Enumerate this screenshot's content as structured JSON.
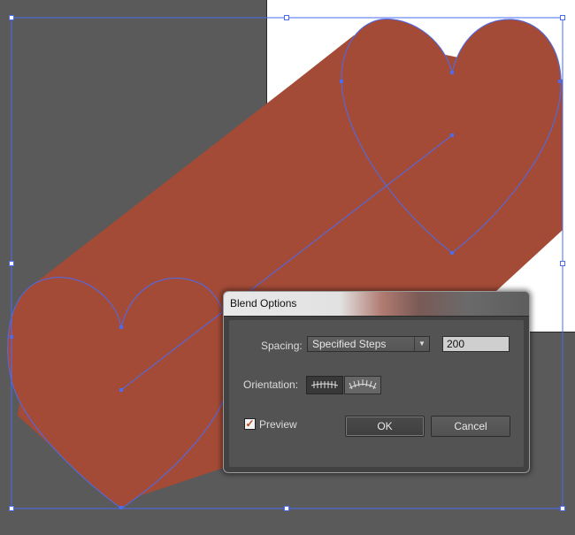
{
  "dialog": {
    "title": "Blend Options",
    "spacing_label": "Spacing:",
    "spacing_value": "Specified Steps",
    "steps_value": "200",
    "orientation_label": "Orientation:",
    "orientation_options": [
      "Align to Page",
      "Align to Path"
    ],
    "orientation_selected": "Align to Page",
    "preview_label": "Preview",
    "preview_checked": true,
    "ok_label": "OK",
    "cancel_label": "Cancel"
  },
  "colors": {
    "workspace": "#5a5a5a",
    "artboard": "#ffffff",
    "blend_fill": "#a34b37",
    "selection": "#4a6cf0"
  },
  "icons": {
    "dropdown_arrow": "chevron-down-icon",
    "align_to_page": "align-to-page-icon",
    "align_to_path": "align-to-path-icon",
    "checkmark": "checkmark-icon"
  }
}
